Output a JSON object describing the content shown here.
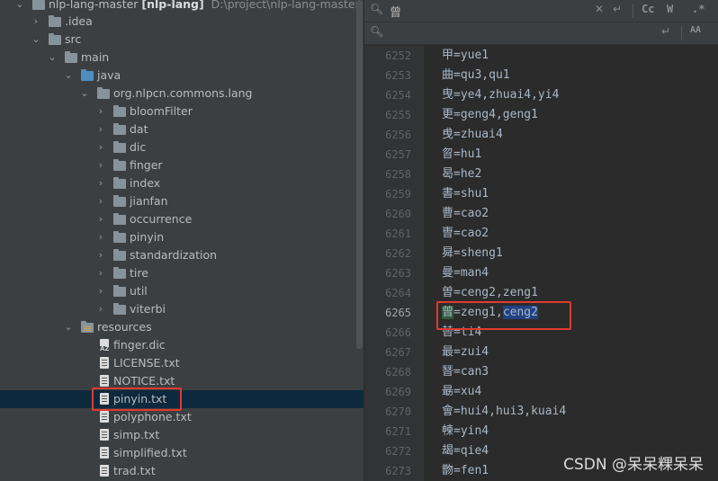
{
  "project_tree": {
    "root": {
      "name": "nlp-lang-master",
      "module": "[nlp-lang]",
      "path": "D:\\project\\nlp-lang-master"
    },
    "items": [
      {
        "label": ".idea"
      },
      {
        "label": "src"
      },
      {
        "label": "main"
      },
      {
        "label": "java"
      },
      {
        "label": "org.nlpcn.commons.lang"
      },
      {
        "label": "bloomFilter"
      },
      {
        "label": "dat"
      },
      {
        "label": "dic"
      },
      {
        "label": "finger"
      },
      {
        "label": "index"
      },
      {
        "label": "jianfan"
      },
      {
        "label": "occurrence"
      },
      {
        "label": "pinyin"
      },
      {
        "label": "standardization"
      },
      {
        "label": "tire"
      },
      {
        "label": "util"
      },
      {
        "label": "viterbi"
      },
      {
        "label": "resources"
      },
      {
        "label": "finger.dic"
      },
      {
        "label": "LICENSE.txt"
      },
      {
        "label": "NOTICE.txt"
      },
      {
        "label": "pinyin.txt"
      },
      {
        "label": "polyphone.txt"
      },
      {
        "label": "simp.txt"
      },
      {
        "label": "simplified.txt"
      },
      {
        "label": "trad.txt"
      }
    ],
    "selected": "pinyin.txt"
  },
  "find_bar": {
    "search_value": "曾",
    "replace_value": "",
    "case_label": "Cc",
    "word_label": "W",
    "regex_label": ".*",
    "preserve_case_label": "AA"
  },
  "editor": {
    "current_line": "6265",
    "lines": [
      {
        "num": "6252",
        "text": "甲=yue1"
      },
      {
        "num": "6253",
        "text": "曲=qu3,qu1"
      },
      {
        "num": "6254",
        "text": "曳=ye4,zhuai4,yi4"
      },
      {
        "num": "6255",
        "text": "更=geng4,geng1"
      },
      {
        "num": "6256",
        "text": "曵=zhuai4"
      },
      {
        "num": "6257",
        "text": "曶=hu1"
      },
      {
        "num": "6258",
        "text": "曷=he2"
      },
      {
        "num": "6259",
        "text": "書=shu1"
      },
      {
        "num": "6260",
        "text": "曹=cao2"
      },
      {
        "num": "6261",
        "text": "曺=cao2"
      },
      {
        "num": "6262",
        "text": "曻=sheng1"
      },
      {
        "num": "6263",
        "text": "曼=man4"
      },
      {
        "num": "6264",
        "text": "曽=ceng2,zeng1"
      },
      {
        "num": "6265",
        "char": "曾",
        "text_a": "=zeng1,",
        "text_b": "ceng2"
      },
      {
        "num": "6266",
        "text": "替=ti4"
      },
      {
        "num": "6267",
        "text": "最=zui4"
      },
      {
        "num": "6268",
        "text": "朁=can3"
      },
      {
        "num": "6269",
        "text": "朂=xu4"
      },
      {
        "num": "6270",
        "text": "會=hui4,hui3,kuai4"
      },
      {
        "num": "6271",
        "text": "朄=yin4"
      },
      {
        "num": "6272",
        "text": "朅=qie4"
      },
      {
        "num": "6273",
        "text": "朆=fen1"
      }
    ]
  },
  "watermark": "CSDN @呆呆粿呆呆"
}
